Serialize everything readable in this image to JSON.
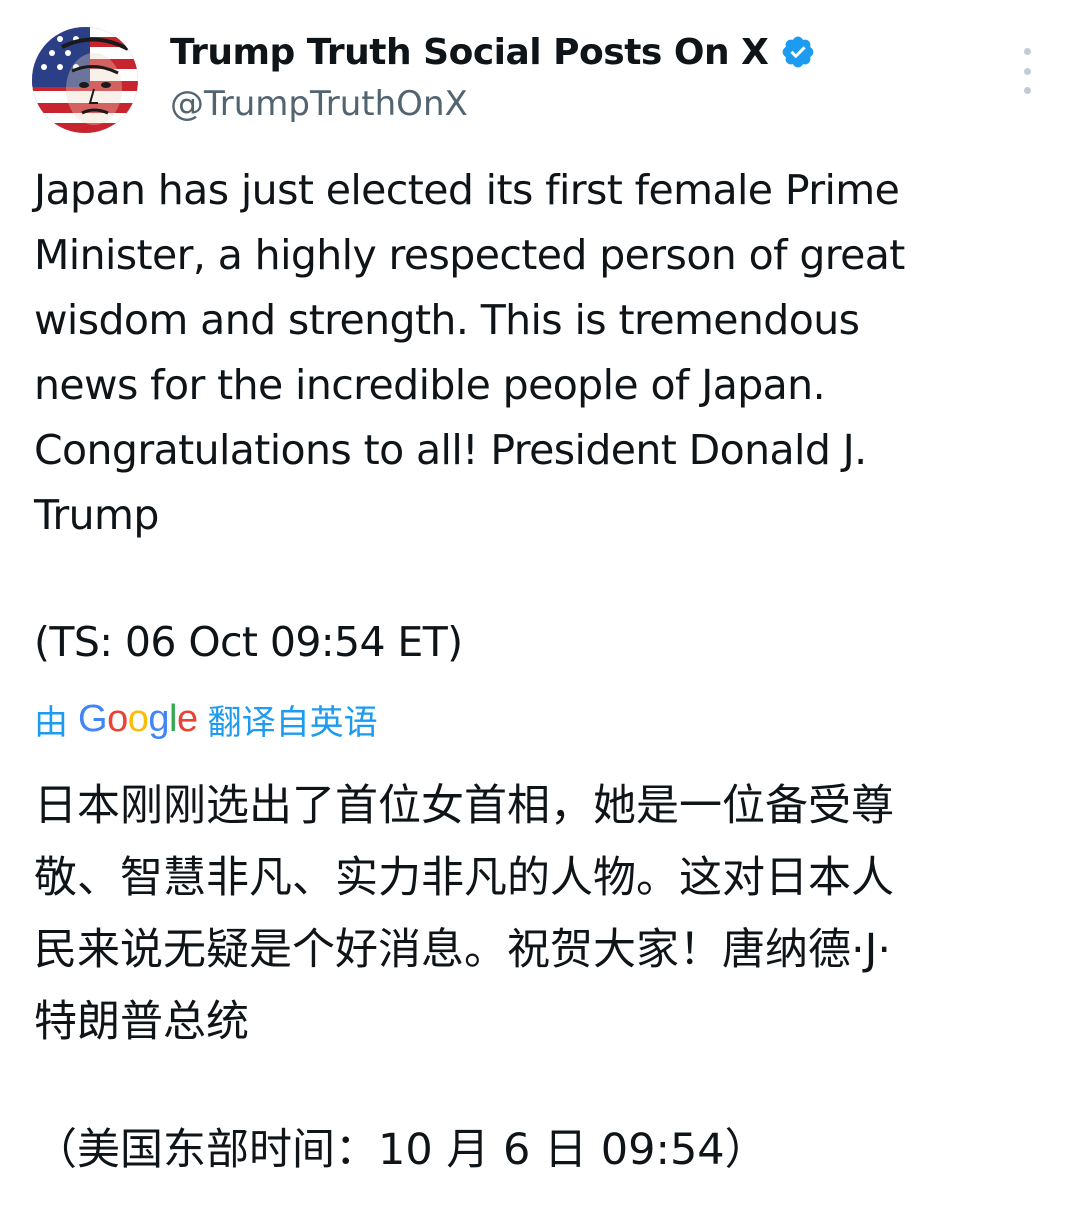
{
  "header": {
    "display_name": "Trump Truth Social Posts On X",
    "handle": "@TrumpTruthOnX",
    "verified": true,
    "avatar_icon": "avatar-image",
    "more_icon": "more-vertical-icon"
  },
  "post": {
    "english_lines": [
      "Japan has just elected its first female Prime",
      "Minister, a highly respected person of great",
      "wisdom and strength. This is tremendous",
      "news for the incredible people of Japan.",
      "Congratulations to all! President Donald J.",
      "Trump"
    ],
    "timestamp": "(TS: 06 Oct 09:54 ET)"
  },
  "translation": {
    "prefix": "由",
    "provider": "Google",
    "suffix": "翻译自英语",
    "chinese_lines": [
      "日本刚刚选出了首位女首相，她是一位备受尊",
      "敬、智慧非凡、实力非凡的人物。这对日本人",
      "民来说无疑是个好消息。祝贺大家！唐纳德·J·",
      "特朗普总统"
    ],
    "timestamp": "（美国东部时间：10 月 6 日 09:54）"
  },
  "colors": {
    "text": "#0f1419",
    "secondary": "#536471",
    "link": "#1d9bf0",
    "verified_badge": "#1d9bf0"
  }
}
